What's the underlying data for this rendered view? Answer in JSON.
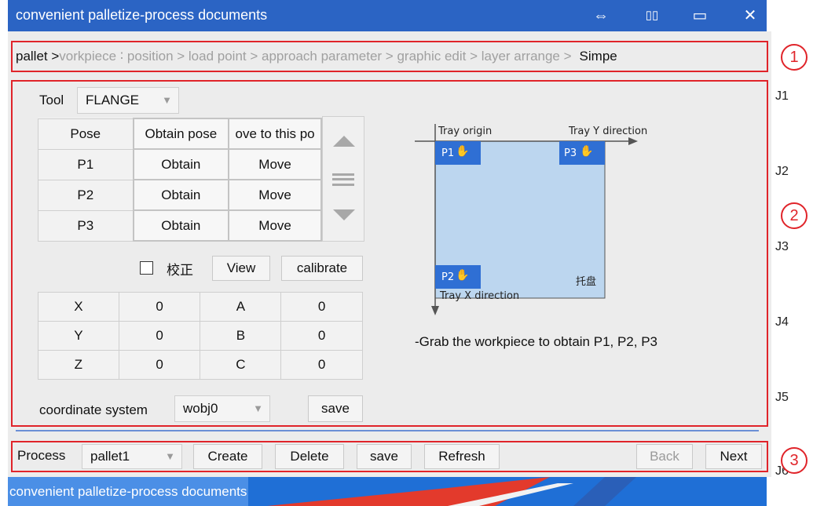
{
  "window": {
    "title": "convenient palletize-process documents",
    "controls": [
      "⇔",
      "▯▯",
      "▭",
      "✕"
    ]
  },
  "breadcrumb": {
    "active": "pallet >",
    "steps": " vorkpiece ∶ position > load point > approach parameter > graphic edit > layer arrange >",
    "tail": "Simpe"
  },
  "tool": {
    "label": "Tool",
    "value": "FLANGE"
  },
  "pose_table": {
    "headers": [
      "Pose",
      "Obtain pose",
      "ove to this po"
    ],
    "rows": [
      {
        "pose": "P1",
        "obtain": "Obtain",
        "move": "Move"
      },
      {
        "pose": "P2",
        "obtain": "Obtain",
        "move": "Move"
      },
      {
        "pose": "P3",
        "obtain": "Obtain",
        "move": "Move"
      }
    ]
  },
  "checkbox": {
    "label": "校正",
    "checked": false
  },
  "buttons": {
    "view": "View",
    "calibrate": "calibrate",
    "save": "save"
  },
  "coord_table": {
    "rows": [
      [
        "X",
        "0",
        "A",
        "0"
      ],
      [
        "Y",
        "0",
        "B",
        "0"
      ],
      [
        "Z",
        "0",
        "C",
        "0"
      ]
    ]
  },
  "coordinate_system": {
    "label": "coordinate system",
    "value": "wobj0"
  },
  "diagram": {
    "tray_origin": "Tray origin",
    "tray_y": "Tray Y direction",
    "tray_x": "Tray X direction",
    "p1": "P1",
    "p2": "P2",
    "p3": "P3",
    "tray": "托盘",
    "tray_color": "#bcd6ef",
    "marker_color": "#2f6fd4"
  },
  "hint": "-Grab the workpiece to obtain P1, P2, P3",
  "joints": [
    "J1",
    "J2",
    "J3",
    "J4",
    "J5",
    "J6"
  ],
  "annotations": [
    "1",
    "2",
    "3"
  ],
  "bottom": {
    "process_label": "Process",
    "process_value": "pallet1",
    "create": "Create",
    "delete": "Delete",
    "save": "save",
    "refresh": "Refresh",
    "back": "Back",
    "next": "Next"
  },
  "taskbar": {
    "task": "convenient palletize-process documents"
  },
  "colors": {
    "title_bar": "#2b64c4",
    "highlight": "#e0242a",
    "taskbar": "#1f6fd6"
  }
}
